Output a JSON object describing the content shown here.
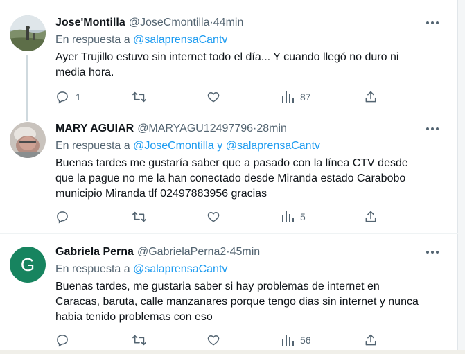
{
  "tweets": [
    {
      "name": "Jose'Montilla",
      "handle": "@JoseCmontilla",
      "time": "44min",
      "reply_prefix": "En respuesta a ",
      "mentions": [
        "@salaprensaCantv"
      ],
      "text_lines": [
        "Ayer Trujillo estuvo sin internet todo el día... Y cuando llegó no duro ni",
        "media hora."
      ],
      "replies": "1",
      "retweets": "",
      "likes": "",
      "views": "87",
      "avatar": "landscape-photo"
    },
    {
      "name": "MARY AGUIAR",
      "handle": "@MARYAGU12497796",
      "time": "28min",
      "reply_prefix": "En respuesta a ",
      "mentions": [
        "@JoseCmontilla",
        "@salaprensaCantv"
      ],
      "mention_joiner": " y ",
      "text_lines": [
        "Buenas tardes me gustaría saber que a pasado con la línea CTV desde",
        "que la pague no me la han conectado desde Miranda estado Carabobo",
        "municipio Miranda tlf 02497883956 gracias"
      ],
      "replies": "",
      "retweets": "",
      "likes": "",
      "views": "5",
      "avatar": "portrait-photo"
    },
    {
      "name": "Gabriela Perna",
      "handle": "@GabrielaPerna2",
      "time": "45min",
      "reply_prefix": "En respuesta a ",
      "mentions": [
        "@salaprensaCantv"
      ],
      "text_lines": [
        "Buenas tardes, me gustaria saber si hay problemas de internet en",
        "Caracas, baruta, calle manzanares porque tengo dias sin internet y nunca",
        "habia tenido problemas con eso"
      ],
      "replies": "",
      "retweets": "",
      "likes": "",
      "views": "56",
      "avatar_letter": "G",
      "avatar_color": "#17845f"
    }
  ],
  "separator": " · ",
  "colors": {
    "link": "#1d9bf0",
    "secondary": "#536471",
    "text": "#0f1419"
  }
}
